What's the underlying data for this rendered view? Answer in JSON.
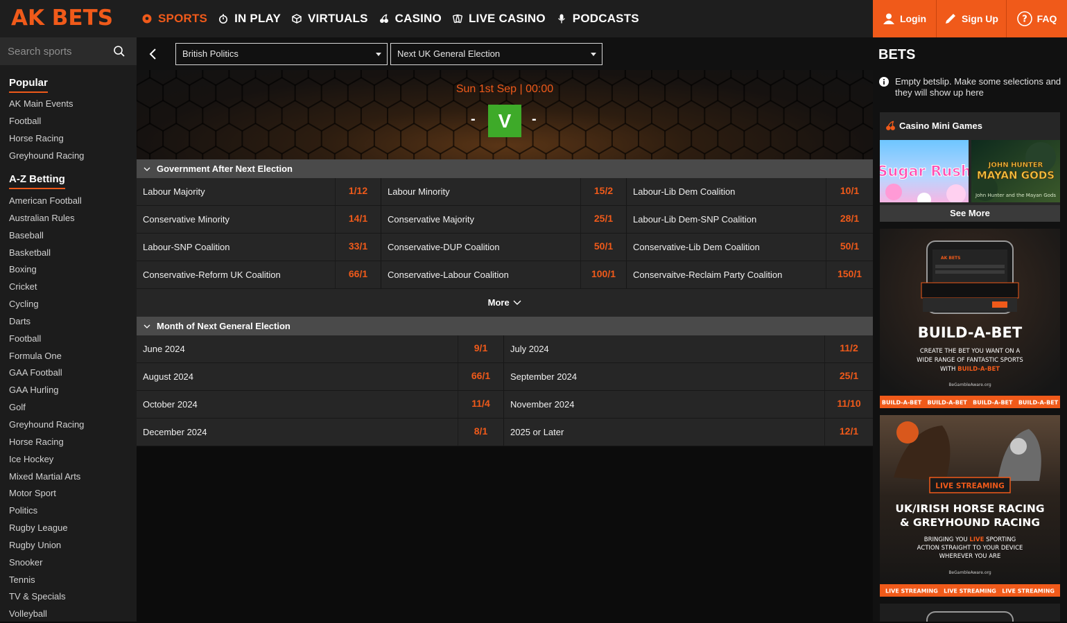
{
  "brand": {
    "logo": "AK BETS",
    "accent": "#f05a1a"
  },
  "nav": {
    "items": [
      {
        "label": "SPORTS",
        "icon": "soccer-ball-icon",
        "active": true
      },
      {
        "label": "IN PLAY",
        "icon": "stopwatch-icon",
        "active": false
      },
      {
        "label": "VIRTUALS",
        "icon": "cube-icon",
        "active": false
      },
      {
        "label": "CASINO",
        "icon": "cherries-icon",
        "active": false
      },
      {
        "label": "LIVE CASINO",
        "icon": "cards-icon",
        "active": false
      },
      {
        "label": "PODCASTS",
        "icon": "microphone-icon",
        "active": false
      }
    ]
  },
  "auth": {
    "login": "Login",
    "signup": "Sign Up",
    "faq": "FAQ"
  },
  "sidebar": {
    "search_placeholder": "Search sports",
    "popular_title": "Popular",
    "popular": [
      "AK Main Events",
      "Football",
      "Horse Racing",
      "Greyhound Racing"
    ],
    "az_title": "A-Z Betting",
    "az": [
      "American Football",
      "Australian Rules",
      "Baseball",
      "Basketball",
      "Boxing",
      "Cricket",
      "Cycling",
      "Darts",
      "Football",
      "Formula One",
      "GAA Football",
      "GAA Hurling",
      "Golf",
      "Greyhound Racing",
      "Horse Racing",
      "Ice Hockey",
      "Mixed Martial Arts",
      "Motor Sport",
      "Politics",
      "Rugby League",
      "Rugby Union",
      "Snooker",
      "Tennis",
      "TV & Specials",
      "Volleyball"
    ]
  },
  "filters": {
    "category": "British Politics",
    "event": "Next UK General Election"
  },
  "event": {
    "date": "Sun 1st Sep | 00:00",
    "home": "-",
    "vs": "V",
    "away": "-"
  },
  "markets": [
    {
      "title": "Government After Next Election",
      "more_label": "More",
      "rows": [
        [
          {
            "name": "Labour Majority",
            "odds": "1/12"
          },
          {
            "name": "Labour Minority",
            "odds": "15/2"
          },
          {
            "name": "Labour-Lib Dem Coalition",
            "odds": "10/1"
          }
        ],
        [
          {
            "name": "Conservative Minority",
            "odds": "14/1"
          },
          {
            "name": "Conservative Majority",
            "odds": "25/1"
          },
          {
            "name": "Labour-Lib Dem-SNP Coalition",
            "odds": "28/1"
          }
        ],
        [
          {
            "name": "Labour-SNP Coalition",
            "odds": "33/1"
          },
          {
            "name": "Conservative-DUP Coalition",
            "odds": "50/1"
          },
          {
            "name": "Conservative-Lib Dem Coalition",
            "odds": "50/1"
          }
        ],
        [
          {
            "name": "Conservative-Reform UK Coalition",
            "odds": "66/1"
          },
          {
            "name": "Conservative-Labour Coalition",
            "odds": "100/1"
          },
          {
            "name": "Conservaitve-Reclaim Party Coalition",
            "odds": "150/1"
          }
        ]
      ]
    },
    {
      "title": "Month of Next General Election",
      "rows": [
        [
          {
            "name": "June 2024",
            "odds": "9/1"
          },
          {
            "name": "July 2024",
            "odds": "11/2"
          }
        ],
        [
          {
            "name": "August 2024",
            "odds": "66/1"
          },
          {
            "name": "September 2024",
            "odds": "25/1"
          }
        ],
        [
          {
            "name": "October 2024",
            "odds": "11/4"
          },
          {
            "name": "November 2024",
            "odds": "11/10"
          }
        ],
        [
          {
            "name": "December 2024",
            "odds": "8/1"
          },
          {
            "name": "2025 or Later",
            "odds": "12/1"
          }
        ]
      ]
    }
  ],
  "betslip": {
    "title": "BETS",
    "empty_message": "Empty betslip. Make some selections and they will show up here",
    "mini_games_title": "Casino Mini Games",
    "games": [
      "Sugar Rush",
      "John Hunter and the Mayan Gods"
    ],
    "see_more": "See More",
    "promo1": {
      "app_name": "AK BETS",
      "headline": "BUILD-A-BET",
      "body_1": "CREATE THE BET YOU WANT ON A",
      "body_2": "WIDE RANGE OF FANTASTIC SPORTS",
      "body_3a": "WITH ",
      "body_3b": "BUILD-A-BET",
      "aware": "BeGambleAware.org",
      "ticker": "BUILD-A-BET   BUILD-A-BET   BUILD-A-BET   BUILD-A-BET"
    },
    "promo2": {
      "tag": "LIVE STREAMING",
      "headline_1": "UK/IRISH HORSE RACING",
      "headline_2": "& GREYHOUND RACING",
      "body_1a": "BRINGING YOU ",
      "body_1b": "LIVE",
      "body_1c": " SPORTING",
      "body_2": "ACTION STRAIGHT TO YOUR DEVICE",
      "body_3": "WHEREVER YOU ARE",
      "aware": "BeGambleAware.org",
      "ticker": "LIVE STREAMING   LIVE STREAMING   LIVE STREAMING"
    }
  }
}
